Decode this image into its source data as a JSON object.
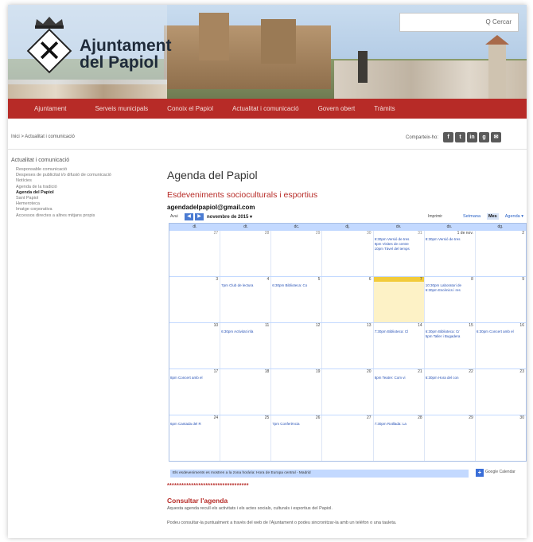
{
  "header": {
    "title_line1": "Ajuntament",
    "title_line2": "del Papiol",
    "search_label": "Q Cercar"
  },
  "nav": {
    "items": [
      "Ajuntament",
      "Serveis municipals",
      "Conoix el Papiol",
      "Actualitat i comunicació",
      "Govern obert",
      "Tràmits"
    ]
  },
  "breadcrumb": "Inici > Actualitat i comunicació",
  "share": {
    "label": "Comparteix-ho:",
    "buttons": [
      "f",
      "t",
      "in",
      "g",
      "✉"
    ]
  },
  "sidebar": {
    "title": "Actualitat i comunicació",
    "items": [
      {
        "label": "Responsable comunicació"
      },
      {
        "label": "Despeses de publicitat i/o difusió de comunicació"
      },
      {
        "label": "Notícies"
      },
      {
        "label": "Agenda de la tradició"
      },
      {
        "label": "Agenda del Papiol"
      },
      {
        "label": "Sant Papiol"
      },
      {
        "label": "Hemeroteca"
      },
      {
        "label": "Imatge corporativa"
      },
      {
        "label": "Accessos directes a altres mitjans propis"
      }
    ]
  },
  "main": {
    "title": "Agenda del Papiol",
    "subtitle": "Esdeveniments socioculturals i esportius",
    "calendar_email": "agendadelpapiol@gmail.com",
    "stars": "**********************************",
    "consult_title": "Consultar l'agenda",
    "paragraph1": "Aquesta agenda recull els activitats i els actes socials, culturals i esportius del Papiol.",
    "paragraph2": "Podeu consultar-la puntualment a través del web de l'Ajuntament o podeu sincronitzar-la amb un telèfon o una tauleta."
  },
  "calendar": {
    "today_label": "Avui",
    "prev": "◀",
    "next": "▶",
    "month_label": "novembre de 2015 ▾",
    "print_label": "Imprimir",
    "views": [
      "Setmana",
      "Mes",
      "Agenda ▾"
    ],
    "active_view": "Mes",
    "days_of_week": [
      "dl.",
      "dt.",
      "dc.",
      "dj.",
      "dv.",
      "ds.",
      "dg."
    ],
    "weeks": [
      {
        "days": [
          {
            "n": "27",
            "dim": true,
            "events": []
          },
          {
            "n": "28",
            "dim": true,
            "events": []
          },
          {
            "n": "29",
            "dim": true,
            "events": []
          },
          {
            "n": "30",
            "dim": true,
            "events": []
          },
          {
            "n": "31",
            "dim": true,
            "events": [
              "9:30pm Versió de tres",
              "9pm Visites de centre",
              "10pm Tàvel del temps"
            ]
          },
          {
            "n": "1 de nov.",
            "dim": false,
            "events": [
              "8:30pm Versió de tres"
            ]
          },
          {
            "n": "2",
            "dim": false,
            "events": []
          }
        ]
      },
      {
        "days": [
          {
            "n": "3",
            "dim": false,
            "events": []
          },
          {
            "n": "4",
            "dim": false,
            "events": [
              "7pm Club de lectura"
            ]
          },
          {
            "n": "5",
            "dim": false,
            "events": [
              "6:30pm Biblioteca: Co"
            ]
          },
          {
            "n": "6",
            "dim": false,
            "events": []
          },
          {
            "n": "7",
            "dim": false,
            "today": true,
            "events": []
          },
          {
            "n": "8",
            "dim": false,
            "events": [
              "10:30pm Laboratori de",
              "6:30pm Escènics i res"
            ]
          },
          {
            "n": "9",
            "dim": false,
            "events": []
          }
        ]
      },
      {
        "days": [
          {
            "n": "10",
            "dim": false,
            "events": []
          },
          {
            "n": "11",
            "dim": false,
            "events": [
              "6:30pm Activitat infa"
            ]
          },
          {
            "n": "12",
            "dim": false,
            "events": []
          },
          {
            "n": "13",
            "dim": false,
            "events": []
          },
          {
            "n": "14",
            "dim": false,
            "events": [
              "7:30pm Biblioteca: Cl"
            ]
          },
          {
            "n": "15",
            "dim": false,
            "events": [
              "6:30pm Biblioteca: Cr",
              "5pm Taller i Bugadera"
            ]
          },
          {
            "n": "16",
            "dim": false,
            "events": [
              "6:30pm Concert amb el"
            ]
          }
        ]
      },
      {
        "days": [
          {
            "n": "17",
            "dim": false,
            "events": [
              "8pm Concert amb el"
            ]
          },
          {
            "n": "18",
            "dim": false,
            "events": []
          },
          {
            "n": "19",
            "dim": false,
            "events": []
          },
          {
            "n": "20",
            "dim": false,
            "events": []
          },
          {
            "n": "21",
            "dim": false,
            "events": [
              "8pm Teatre: Com vi"
            ]
          },
          {
            "n": "22",
            "dim": false,
            "events": [
              "6:30pm Hora del con"
            ]
          },
          {
            "n": "23",
            "dim": false,
            "events": []
          }
        ]
      },
      {
        "days": [
          {
            "n": "24",
            "dim": false,
            "events": [
              "6pm Cantada del R"
            ]
          },
          {
            "n": "25",
            "dim": false,
            "events": []
          },
          {
            "n": "26",
            "dim": false,
            "events": [
              "7pm Conferència"
            ]
          },
          {
            "n": "27",
            "dim": false,
            "events": []
          },
          {
            "n": "28",
            "dim": false,
            "events": [
              "7:30pm Rotllada: La"
            ]
          },
          {
            "n": "29",
            "dim": false,
            "events": []
          },
          {
            "n": "30",
            "dim": false,
            "events": []
          }
        ]
      }
    ],
    "timezone_note": "Els esdeveniments es mostren a la zona horària: Hora de Europa central - Madrid",
    "google_label": "Google Calendar"
  },
  "colors": {
    "brand_red": "#b72b27",
    "calendar_blue": "#c3d9ff",
    "today_yellow": "#fdf2c6"
  }
}
